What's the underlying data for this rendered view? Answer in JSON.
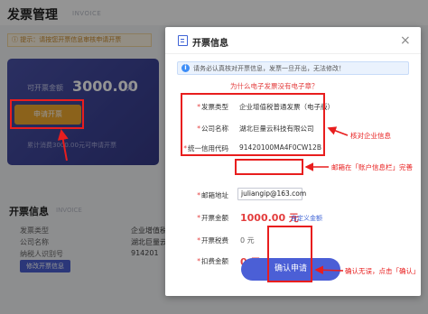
{
  "background": {
    "title": "发票管理",
    "title_en": "INVOICE",
    "notice": "ⓘ 提示：请按您开票信息审核申请开票",
    "card": {
      "amount_label": "可开票金额",
      "amount": "3000.00",
      "amount_unit": "元",
      "apply_button": "申请开票",
      "note": "累计消费3000.00元可申请开票"
    },
    "section": {
      "title": "开票信息",
      "title_en": "INVOICE",
      "rows": [
        {
          "label": "发票类型",
          "value": "企业增值税普"
        },
        {
          "label": "公司名称",
          "value": "湖北巨量云"
        },
        {
          "label": "纳税人识别号",
          "value": "914201"
        }
      ],
      "edit_button": "修改开票信息"
    }
  },
  "modal": {
    "title": "开票信息",
    "close_icon": "×",
    "info_icon": "i",
    "info_text": "请务必认真核对开票信息，发票一旦开出，无法修改！",
    "no_einvoice_link": "为什么电子发票没有电子章？",
    "fields": {
      "invoice_type": {
        "label": "发票类型",
        "value": "企业增值税普通发票（电子版）"
      },
      "company_name": {
        "label": "公司名称",
        "value": "湖北巨量云科技有限公司"
      },
      "credit_code": {
        "label": "统一信用代码",
        "value": "91420100MA4F0CW12B"
      },
      "email": {
        "label": "邮箱地址",
        "value": "juliangip@163.com"
      },
      "amount": {
        "label": "开票金额",
        "value": "1000.00 元"
      },
      "tax": {
        "label": "开票税费",
        "value": "0 元"
      },
      "deduct": {
        "label": "扣费金额",
        "value": "0 元"
      }
    },
    "required_mark": "*",
    "custom_amount_link": "自定义金额",
    "confirm_button": "确认申请"
  },
  "annotations": {
    "verify_company": "核对企业信息",
    "email_note": "邮箱在「账户信息栏」完善",
    "confirm_note": "确认无误，点击「确认」"
  },
  "colors": {
    "primary": "#4b5fd6",
    "danger": "#e33d3d",
    "annotation": "#e81e1e",
    "card_bg": "#3c4396",
    "apply_btn": "#f0a92f"
  }
}
